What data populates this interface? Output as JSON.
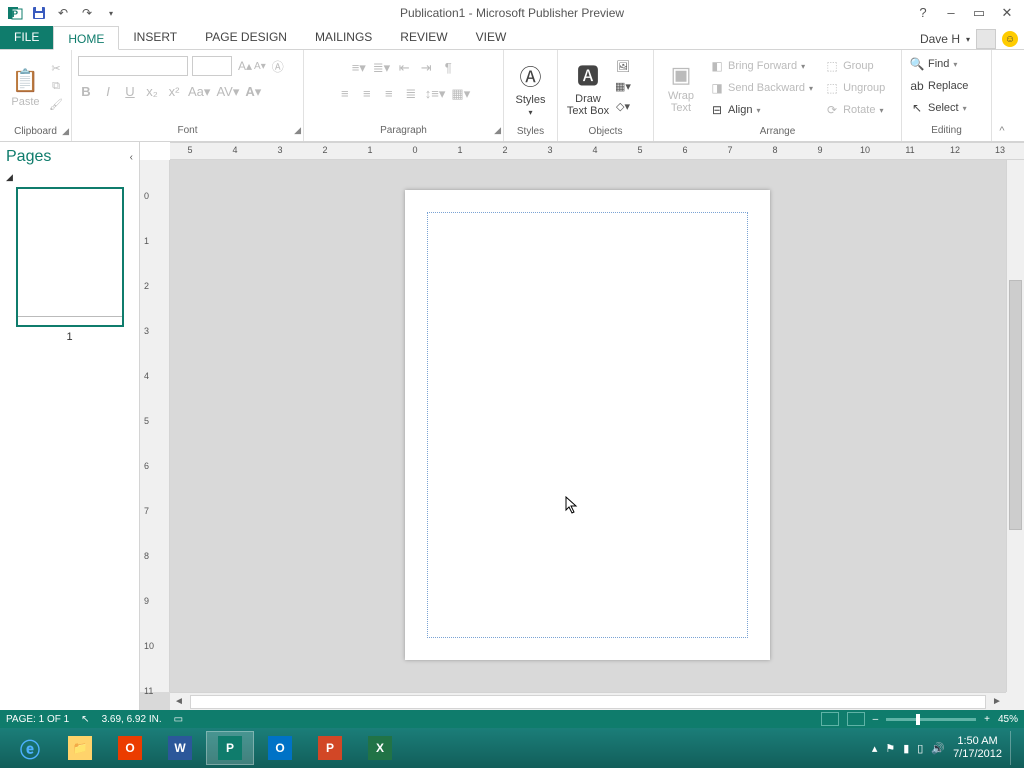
{
  "title": "Publication1 - Microsoft Publisher Preview",
  "qat": {
    "undo": "↶",
    "redo": "↷"
  },
  "win": {
    "help": "?",
    "min": "–",
    "max": "▭",
    "close": "✕"
  },
  "tabs": {
    "file": "FILE",
    "home": "HOME",
    "insert": "INSERT",
    "page_design": "PAGE DESIGN",
    "mailings": "MAILINGS",
    "review": "REVIEW",
    "view": "VIEW"
  },
  "user": {
    "name": "Dave H"
  },
  "ribbon": {
    "clipboard": {
      "label": "Clipboard",
      "paste": "Paste"
    },
    "font": {
      "label": "Font"
    },
    "paragraph": {
      "label": "Paragraph"
    },
    "styles": {
      "label": "Styles",
      "btn": "Styles"
    },
    "objects": {
      "label": "Objects",
      "draw": "Draw\nText Box"
    },
    "wrap": {
      "btn": "Wrap\nText"
    },
    "arrange": {
      "label": "Arrange",
      "bring": "Bring Forward",
      "send": "Send Backward",
      "align": "Align",
      "group": "Group",
      "ungroup": "Ungroup",
      "rotate": "Rotate"
    },
    "editing": {
      "label": "Editing",
      "find": "Find",
      "replace": "Replace",
      "select": "Select"
    }
  },
  "pages": {
    "title": "Pages",
    "thumb_num": "1"
  },
  "status": {
    "page": "PAGE: 1 OF 1",
    "pos": "3.69, 6.92 IN.",
    "zoom": "45%",
    "minus": "–",
    "plus": "+"
  },
  "hruler_nums": [
    "5",
    "4",
    "3",
    "2",
    "1",
    "0",
    "1",
    "2",
    "3",
    "4",
    "5",
    "6",
    "7",
    "8",
    "9",
    "10",
    "11",
    "12",
    "13"
  ],
  "vruler_nums": [
    "0",
    "1",
    "2",
    "3",
    "4",
    "5",
    "6",
    "7",
    "8",
    "9",
    "10",
    "11"
  ],
  "taskbar": {
    "apps": [
      "ie",
      "explorer",
      "office",
      "word",
      "publisher",
      "outlook",
      "powerpoint",
      "excel"
    ],
    "time": "1:50 AM",
    "date": "7/17/2012"
  },
  "cursor_glyph": "⬉"
}
